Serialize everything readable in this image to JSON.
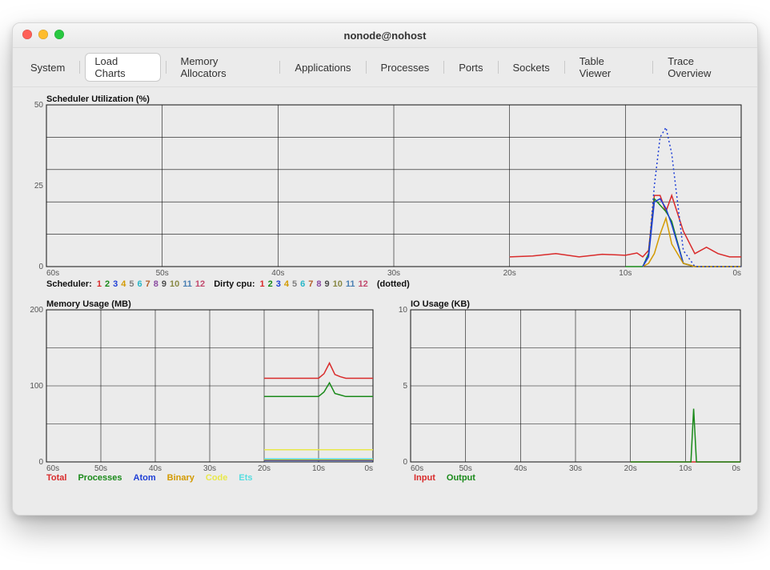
{
  "window": {
    "title": "nonode@nohost"
  },
  "tabs": [
    "System",
    "Load Charts",
    "Memory Allocators",
    "Applications",
    "Processes",
    "Ports",
    "Sockets",
    "Table Viewer",
    "Trace Overview"
  ],
  "active_tab": "Load Charts",
  "palette12": [
    "#d92b2b",
    "#1a8a1a",
    "#1f3fd6",
    "#d39a00",
    "#7f7f7f",
    "#26b6c7",
    "#b35f2a",
    "#8a4aa0",
    "#4a4a4a",
    "#888844",
    "#4a7fb3",
    "#c24a6e"
  ],
  "chart_data": [
    {
      "name": "scheduler",
      "type": "line",
      "title": "Scheduler Utilization (%)",
      "xlabel": "",
      "ylabel": "",
      "xlim": [
        60,
        0
      ],
      "ylim": [
        0,
        50
      ],
      "x_ticks": [
        60,
        50,
        40,
        30,
        20,
        10,
        0
      ],
      "x_tick_labels": [
        "60s",
        "50s",
        "40s",
        "30s",
        "20s",
        "10s",
        "0s"
      ],
      "y_ticks": [
        0,
        25,
        50
      ],
      "x": [
        60,
        55,
        50,
        45,
        40,
        35,
        30,
        25,
        20,
        18,
        16,
        14,
        12,
        10,
        9,
        8.5,
        8,
        7.5,
        7,
        6.5,
        6,
        5,
        4,
        3,
        2,
        1,
        0
      ],
      "series": [
        {
          "name": "Scheduler 1",
          "color": "#d92b2b",
          "style": "solid",
          "values": [
            null,
            null,
            null,
            null,
            null,
            null,
            null,
            null,
            3,
            3.3,
            4,
            3,
            3.8,
            3.5,
            4.2,
            3,
            5,
            22,
            22,
            17,
            22,
            11,
            4,
            6,
            4,
            3,
            3
          ]
        },
        {
          "name": "Scheduler 2",
          "color": "#1a8a1a",
          "style": "solid",
          "values": [
            null,
            null,
            null,
            null,
            null,
            null,
            null,
            null,
            null,
            null,
            null,
            null,
            null,
            0,
            0,
            0,
            4,
            21,
            19,
            17,
            14,
            1,
            0,
            0,
            0,
            0,
            0
          ]
        },
        {
          "name": "Scheduler 3",
          "color": "#1f3fd6",
          "style": "solid",
          "values": [
            null,
            null,
            null,
            null,
            null,
            null,
            null,
            null,
            null,
            null,
            null,
            null,
            null,
            null,
            null,
            0,
            3,
            20,
            21,
            18,
            13,
            1,
            0,
            0,
            0,
            0,
            0
          ]
        },
        {
          "name": "Scheduler 4",
          "color": "#d39a00",
          "style": "solid",
          "values": [
            null,
            null,
            null,
            null,
            null,
            null,
            null,
            null,
            null,
            null,
            null,
            null,
            null,
            null,
            null,
            0,
            1,
            4,
            10,
            15,
            7,
            1,
            0,
            0,
            0,
            0,
            0
          ]
        },
        {
          "name": "Dirty 3 (dotted)",
          "color": "#1f3fd6",
          "style": "dotted",
          "values": [
            null,
            null,
            null,
            null,
            null,
            null,
            null,
            null,
            null,
            null,
            null,
            null,
            null,
            null,
            null,
            0,
            4,
            25,
            40,
            43,
            35,
            5,
            0,
            0,
            0,
            0,
            0
          ]
        }
      ],
      "legend": {
        "scheduler_label": "Scheduler:",
        "dirty_label": "Dirty cpu:",
        "suffix": "(dotted)",
        "numbers": [
          "1",
          "2",
          "3",
          "4",
          "5",
          "6",
          "7",
          "8",
          "9",
          "10",
          "11",
          "12"
        ]
      }
    },
    {
      "name": "memory",
      "type": "line",
      "title": "Memory Usage (MB)",
      "xlim": [
        60,
        0
      ],
      "ylim": [
        0,
        200
      ],
      "x_ticks": [
        60,
        50,
        40,
        30,
        20,
        10,
        0
      ],
      "x_tick_labels": [
        "60s",
        "50s",
        "40s",
        "30s",
        "20s",
        "10s",
        "0s"
      ],
      "y_ticks": [
        0,
        100,
        200
      ],
      "x": [
        60,
        55,
        50,
        45,
        40,
        35,
        30,
        25,
        20,
        18,
        16,
        14,
        12,
        10,
        9,
        8,
        7,
        6,
        5,
        4,
        3,
        2,
        1,
        0
      ],
      "series": [
        {
          "name": "Total",
          "color": "#d92b2b",
          "values": [
            null,
            null,
            null,
            null,
            null,
            null,
            null,
            null,
            110,
            110,
            110,
            110,
            110,
            110,
            116,
            130,
            115,
            112,
            110,
            110,
            110,
            110,
            110,
            110
          ]
        },
        {
          "name": "Processes",
          "color": "#1a8a1a",
          "values": [
            null,
            null,
            null,
            null,
            null,
            null,
            null,
            null,
            86,
            86,
            86,
            86,
            86,
            86,
            92,
            104,
            90,
            88,
            86,
            86,
            86,
            86,
            86,
            86
          ]
        },
        {
          "name": "Atom",
          "color": "#1f3fd6",
          "values": [
            null,
            null,
            null,
            null,
            null,
            null,
            null,
            null,
            2,
            2,
            2,
            2,
            2,
            2,
            2,
            2,
            2,
            2,
            2,
            2,
            2,
            2,
            2,
            2
          ]
        },
        {
          "name": "Binary",
          "color": "#d39a00",
          "values": [
            null,
            null,
            null,
            null,
            null,
            null,
            null,
            null,
            3,
            3,
            3,
            3,
            3,
            3,
            3,
            3,
            3,
            3,
            3,
            3,
            3,
            3,
            3,
            3
          ]
        },
        {
          "name": "Code",
          "color": "#e8e84a",
          "values": [
            null,
            null,
            null,
            null,
            null,
            null,
            null,
            null,
            16,
            16,
            16,
            16,
            16,
            16,
            16,
            16,
            16,
            16,
            16,
            16,
            16,
            16,
            16,
            16
          ]
        },
        {
          "name": "Ets",
          "color": "#55dde0",
          "values": [
            null,
            null,
            null,
            null,
            null,
            null,
            null,
            null,
            4,
            4,
            4,
            4,
            4,
            4,
            4,
            4,
            4,
            4,
            4,
            4,
            4,
            4,
            4,
            4
          ]
        }
      ],
      "legend_items": [
        {
          "label": "Total",
          "color": "#d92b2b"
        },
        {
          "label": "Processes",
          "color": "#1a8a1a"
        },
        {
          "label": "Atom",
          "color": "#1f3fd6"
        },
        {
          "label": "Binary",
          "color": "#d39a00"
        },
        {
          "label": "Code",
          "color": "#e8e84a"
        },
        {
          "label": "Ets",
          "color": "#55dde0"
        }
      ]
    },
    {
      "name": "io",
      "type": "line",
      "title": "IO Usage (KB)",
      "xlim": [
        60,
        0
      ],
      "ylim": [
        0,
        10
      ],
      "x_ticks": [
        60,
        50,
        40,
        30,
        20,
        10,
        0
      ],
      "x_tick_labels": [
        "60s",
        "50s",
        "40s",
        "30s",
        "20s",
        "10s",
        "0s"
      ],
      "y_ticks": [
        0,
        5,
        10
      ],
      "x": [
        60,
        55,
        50,
        45,
        40,
        35,
        30,
        25,
        20,
        15,
        10,
        9,
        8.5,
        8,
        7.5,
        7,
        6,
        5,
        4,
        3,
        2,
        1,
        0
      ],
      "series": [
        {
          "name": "Input",
          "color": "#d92b2b",
          "values": [
            null,
            null,
            null,
            null,
            null,
            null,
            null,
            null,
            0,
            0,
            0,
            0,
            0,
            0,
            0,
            0,
            0,
            0,
            0,
            0,
            0,
            0,
            0
          ]
        },
        {
          "name": "Output",
          "color": "#1a8a1a",
          "values": [
            null,
            null,
            null,
            null,
            null,
            null,
            null,
            null,
            0,
            0,
            0,
            0,
            3.5,
            0,
            0,
            0,
            0,
            0,
            0,
            0,
            0,
            0,
            0
          ]
        }
      ],
      "legend_items": [
        {
          "label": "Input",
          "color": "#d92b2b"
        },
        {
          "label": "Output",
          "color": "#1a8a1a"
        }
      ]
    }
  ]
}
